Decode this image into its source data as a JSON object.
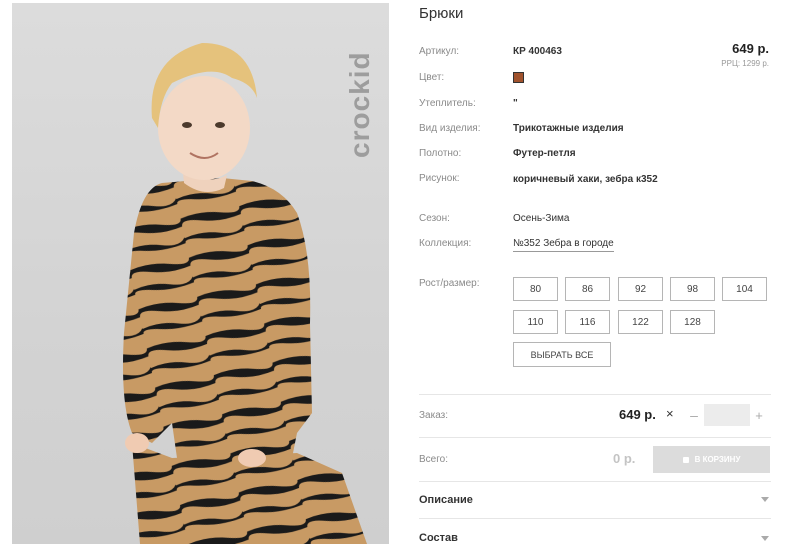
{
  "brand": {
    "logo_text": "crockid"
  },
  "product": {
    "title": "Брюки",
    "price": "649 р.",
    "rrp": "РРЦ: 1299 р.",
    "color_hex": "#a0522d",
    "specs": [
      {
        "label": "Артикул:",
        "value": "КР 400463"
      },
      {
        "label": "Цвет:",
        "value": ""
      },
      {
        "label": "Утеплитель:",
        "value": "\""
      },
      {
        "label": "Вид изделия:",
        "value": "Трикотажные изделия"
      },
      {
        "label": "Полотно:",
        "value": "Футер-петля"
      },
      {
        "label": "Рисунок:",
        "value": "коричневый хаки, зебра к352"
      },
      {
        "label": "Сезон:",
        "value": "Осень-Зима"
      },
      {
        "label": "Коллекция:",
        "value": "№352 Зебра в городе"
      }
    ]
  },
  "sizes": {
    "label": "Рост/размер:",
    "options": [
      "80",
      "86",
      "92",
      "98",
      "104",
      "110",
      "116",
      "122",
      "128"
    ],
    "select_all": "ВЫБРАТЬ ВСЕ"
  },
  "order": {
    "label": "Заказ:",
    "price": "649 р.",
    "times": "×",
    "minus": "–",
    "plus": "+",
    "quantity": ""
  },
  "total": {
    "label": "Всего:",
    "value": "0 р.",
    "cart_button": "В КОРЗИНУ"
  },
  "accordion": [
    {
      "title": "Описание"
    },
    {
      "title": "Состав"
    }
  ]
}
